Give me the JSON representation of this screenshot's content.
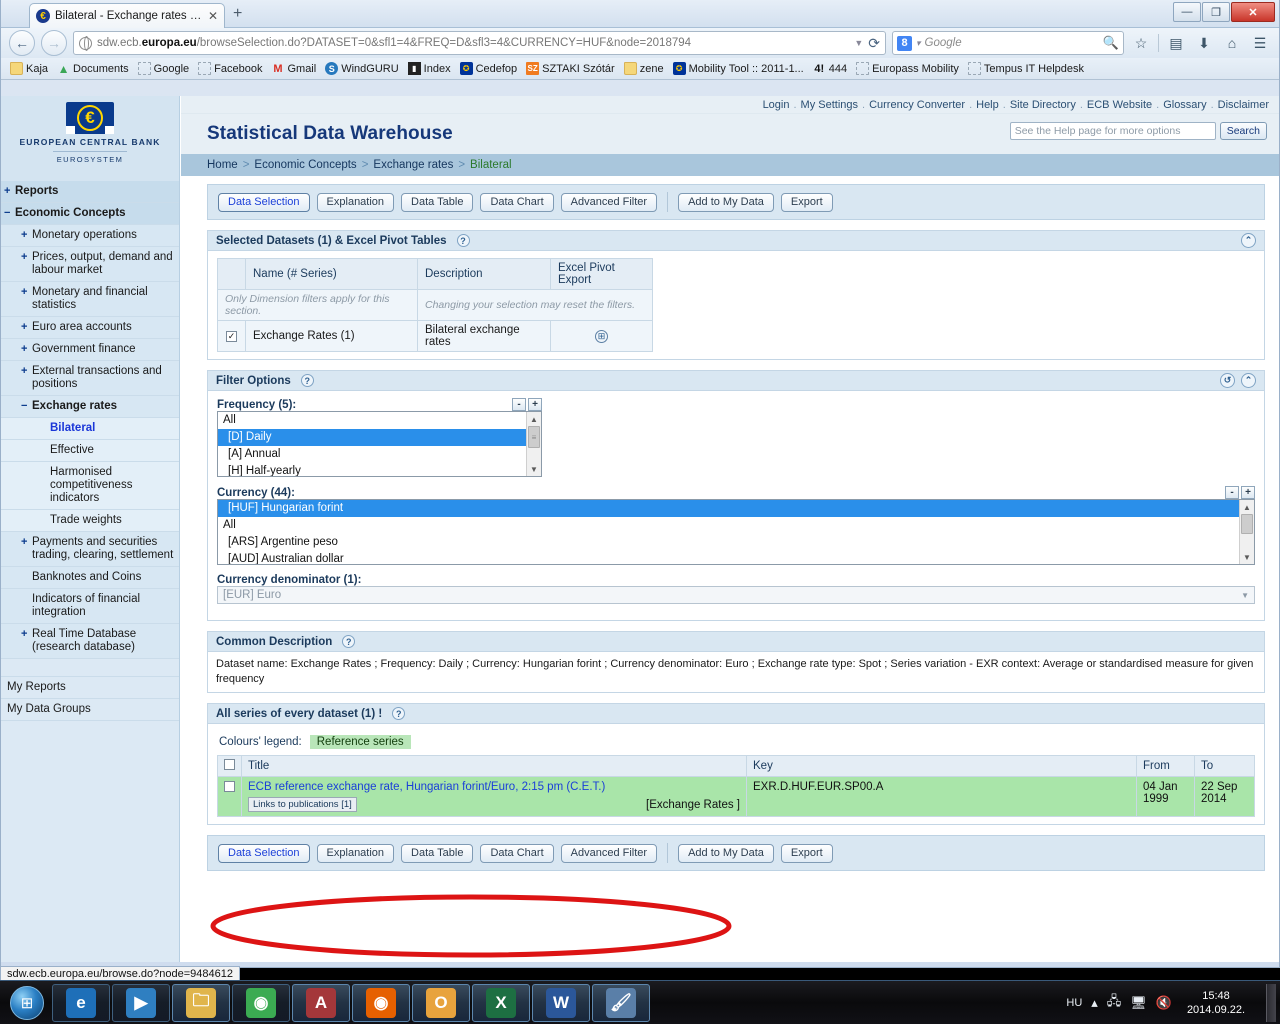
{
  "browser": {
    "tab": {
      "title": "Bilateral - Exchange rates - ...",
      "favicon": "€",
      "close": "✕"
    },
    "newtab": "+",
    "window_controls": {
      "minimize": "—",
      "restore": "❐",
      "close": "✕"
    },
    "nav": {
      "back": "←",
      "forward": "→",
      "reload": "⟳",
      "caret": "▼"
    },
    "url": {
      "prefix": "sdw.ecb.",
      "domain": "europa.eu",
      "path": "/browseSelection.do?DATASET=0&sfl1=4&FREQ=D&sfl3=4&CURRENCY=HUF&node=2018794"
    },
    "search": {
      "engine": "Google",
      "placeholder": "Google",
      "badge": "8"
    },
    "toolbar_icons": {
      "bookmark": "☆",
      "reader": "▤",
      "downloads": "⬇",
      "home": "⌂",
      "menu": "☰"
    },
    "bookmarks": [
      {
        "label": "Kaja",
        "icon": "folder-icon",
        "glyph": ""
      },
      {
        "label": "Documents",
        "icon": "drive-icon",
        "glyph": "▲"
      },
      {
        "label": "Google",
        "icon": "blank-icon",
        "glyph": ""
      },
      {
        "label": "Facebook",
        "icon": "blank-icon",
        "glyph": ""
      },
      {
        "label": "Gmail",
        "icon": "gmail-icon",
        "glyph": "M"
      },
      {
        "label": "WindGURU",
        "icon": "windguru-icon",
        "glyph": "S"
      },
      {
        "label": "Index",
        "icon": "index-icon",
        "glyph": "▮"
      },
      {
        "label": "Cedefop",
        "icon": "eu-icon",
        "glyph": "✪"
      },
      {
        "label": "SZTAKI Szótár",
        "icon": "sztaki-icon",
        "glyph": "SZ"
      },
      {
        "label": "zene",
        "icon": "folder-icon",
        "glyph": ""
      },
      {
        "label": "Mobility Tool :: 2011-1...",
        "icon": "eu-icon",
        "glyph": "✪"
      },
      {
        "label": "444",
        "icon": "444-icon",
        "glyph": "4!"
      },
      {
        "label": "Europass Mobility",
        "icon": "blank-icon",
        "glyph": ""
      },
      {
        "label": "Tempus IT Helpdesk",
        "icon": "blank-icon",
        "glyph": ""
      }
    ],
    "status_bar": "sdw.ecb.europa.eu/browse.do?node=9484612"
  },
  "sidebar": {
    "logo": {
      "name": "EUROPEAN CENTRAL BANK",
      "sub": "EUROSYSTEM",
      "symbol": "€"
    },
    "items": [
      {
        "label": "Reports",
        "marker": "+",
        "level": 0
      },
      {
        "label": "Economic Concepts",
        "marker": "−",
        "level": 0
      },
      {
        "label": "Monetary operations",
        "marker": "+",
        "level": 1
      },
      {
        "label": "Prices, output, demand and labour market",
        "marker": "+",
        "level": 1
      },
      {
        "label": "Monetary and financial statistics",
        "marker": "+",
        "level": 1
      },
      {
        "label": "Euro area accounts",
        "marker": "+",
        "level": 1
      },
      {
        "label": "Government finance",
        "marker": "+",
        "level": 1
      },
      {
        "label": "External transactions and positions",
        "marker": "+",
        "level": 1
      },
      {
        "label": "Exchange rates",
        "marker": "−",
        "level": 1
      },
      {
        "label": "Bilateral",
        "marker": "",
        "level": 2,
        "active": true
      },
      {
        "label": "Effective",
        "marker": "",
        "level": 2
      },
      {
        "label": "Harmonised competitiveness indicators",
        "marker": "",
        "level": 2
      },
      {
        "label": "Trade weights",
        "marker": "",
        "level": 2
      },
      {
        "label": "Payments and securities trading, clearing, settlement",
        "marker": "+",
        "level": 1
      },
      {
        "label": "Banknotes and Coins",
        "marker": "",
        "level": 1
      },
      {
        "label": "Indicators of financial integration",
        "marker": "",
        "level": 1
      },
      {
        "label": "Real Time Database (research database)",
        "marker": "+",
        "level": 1
      }
    ],
    "footer_items": [
      {
        "label": "My Reports"
      },
      {
        "label": "My Data Groups"
      }
    ]
  },
  "header": {
    "top_links": [
      "Login",
      "My Settings",
      "Currency Converter",
      "Help",
      "Site Directory",
      "ECB Website",
      "Glossary",
      "Disclaimer"
    ],
    "separator": ".",
    "title": "Statistical Data Warehouse",
    "help_search_placeholder": "See the Help page for more options",
    "search_button": "Search",
    "breadcrumb": [
      "Home",
      "Economic Concepts",
      "Exchange rates",
      "Bilateral"
    ],
    "breadcrumb_sep": ">"
  },
  "toolbar": {
    "buttons": [
      "Data Selection",
      "Explanation",
      "Data Table",
      "Data Chart",
      "Advanced Filter"
    ],
    "buttons2": [
      "Add to My Data",
      "Export"
    ],
    "active": "Data Selection"
  },
  "datasets_panel": {
    "title": "Selected Datasets (1) & Excel Pivot Tables",
    "help": "?",
    "collapse_icon": "⌃⌃",
    "columns": [
      "",
      "Name (# Series)",
      "Description",
      "Excel Pivot Export"
    ],
    "notes": [
      "Only Dimension filters apply for this section.",
      "Changing your selection may reset the filters."
    ],
    "rows": [
      {
        "checked": "✓",
        "name": "Exchange Rates   (1)",
        "description": "Bilateral exchange rates",
        "pivot": "⊞"
      }
    ]
  },
  "filter_panel": {
    "title": "Filter Options",
    "help": "?",
    "reset_icon": "↺",
    "collapse_icon": "⌃⌃",
    "frequency": {
      "label": "Frequency (5):",
      "minus": "-",
      "plus": "+",
      "options": [
        "All",
        "[D] Daily",
        "[A] Annual",
        "[H] Half-yearly"
      ],
      "selected": "[D] Daily"
    },
    "currency": {
      "label": "Currency  (44):",
      "minus": "-",
      "plus": "+",
      "options": [
        "[HUF] Hungarian forint",
        "All",
        "[ARS] Argentine peso",
        "[AUD] Australian dollar"
      ],
      "selected": "[HUF] Hungarian forint"
    },
    "denominator": {
      "label": "Currency denominator  (1):",
      "value": "[EUR] Euro",
      "arrow": "▼"
    }
  },
  "common_description": {
    "title": "Common Description",
    "help": "?",
    "text": "Dataset name: Exchange Rates ; Frequency: Daily ; Currency: Hungarian forint ; Currency denominator: Euro ; Exchange rate type: Spot ; Series variation - EXR context: Average or standardised measure for given frequency"
  },
  "series_panel": {
    "title": "All series of every dataset (1) !",
    "help": "?",
    "legend_label": "Colours' legend:",
    "legend_chip": "Reference series",
    "columns": [
      "",
      "Title",
      "Key",
      "From",
      "To"
    ],
    "rows": [
      {
        "title": "ECB reference exchange rate, Hungarian forint/Euro, 2:15 pm (C.E.T.)",
        "links_chip": "Links to publications [1]",
        "dataset_tag": "[Exchange Rates ]",
        "key": "EXR.D.HUF.EUR.SP00.A",
        "from": "04 Jan 1999",
        "to": "22 Sep 2014"
      }
    ]
  },
  "annotation": {
    "shape": "ellipse",
    "color": "#dd1414"
  },
  "taskbar": {
    "start": "⊞",
    "apps": [
      {
        "name": "internet-explorer",
        "glyph": "e",
        "color": "#1e6fb8",
        "active": false
      },
      {
        "name": "windows-media-player",
        "glyph": "▶",
        "color": "#2f7fc1",
        "active": false
      },
      {
        "name": "windows-explorer",
        "glyph": "🗀",
        "color": "#e0b54c",
        "active": true
      },
      {
        "name": "google-chrome",
        "glyph": "◉",
        "color": "#3bab52",
        "active": false
      },
      {
        "name": "microsoft-access",
        "glyph": "A",
        "color": "#a4373a",
        "active": true
      },
      {
        "name": "mozilla-firefox",
        "glyph": "◉",
        "color": "#e66000",
        "active": true
      },
      {
        "name": "microsoft-outlook",
        "glyph": "O",
        "color": "#e8a33d",
        "active": true
      },
      {
        "name": "microsoft-excel",
        "glyph": "X",
        "color": "#1d6f42",
        "active": true
      },
      {
        "name": "microsoft-word",
        "glyph": "W",
        "color": "#2b579a",
        "active": true
      },
      {
        "name": "microsoft-paint",
        "glyph": "🖌",
        "color": "#5a7fa8",
        "active": true
      }
    ],
    "tray": {
      "language": "HU",
      "expand": "▴",
      "network_icon": "network-warning-icon",
      "display_icon": "display-icon",
      "volume_icon": "volume-muted-icon",
      "time": "15:48",
      "date": "2014.09.22."
    }
  }
}
